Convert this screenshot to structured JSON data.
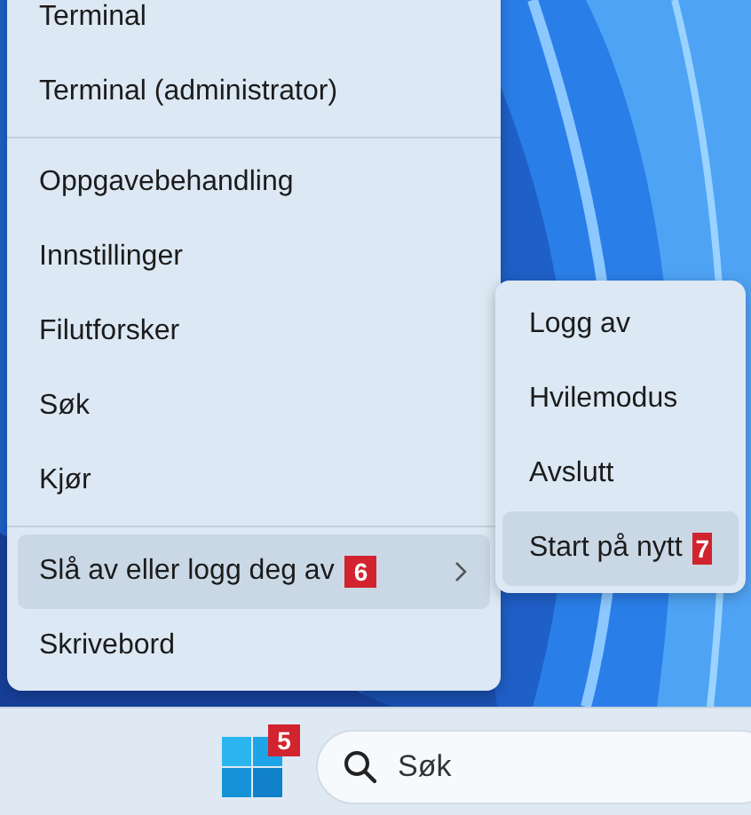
{
  "menu": {
    "groups": [
      [
        {
          "label": "Terminal",
          "selected": false
        },
        {
          "label": "Terminal (administrator)",
          "selected": false
        }
      ],
      [
        {
          "label": "Oppgavebehandling",
          "selected": false
        },
        {
          "label": "Innstillinger",
          "selected": false
        },
        {
          "label": "Filutforsker",
          "selected": false
        },
        {
          "label": "Søk",
          "selected": false
        },
        {
          "label": "Kjør",
          "selected": false
        }
      ],
      [
        {
          "label": "Slå av eller logg deg av",
          "selected": true,
          "badge": "6",
          "submenu": true
        },
        {
          "label": "Skrivebord",
          "selected": false
        }
      ]
    ]
  },
  "submenu": {
    "items": [
      {
        "label": "Logg av",
        "selected": false
      },
      {
        "label": "Hvilemodus",
        "selected": false
      },
      {
        "label": "Avslutt",
        "selected": false
      },
      {
        "label": "Start på nytt",
        "selected": true,
        "badge": "7"
      }
    ]
  },
  "taskbar": {
    "start_badge": "5",
    "search": {
      "placeholder": "Søk"
    }
  }
}
